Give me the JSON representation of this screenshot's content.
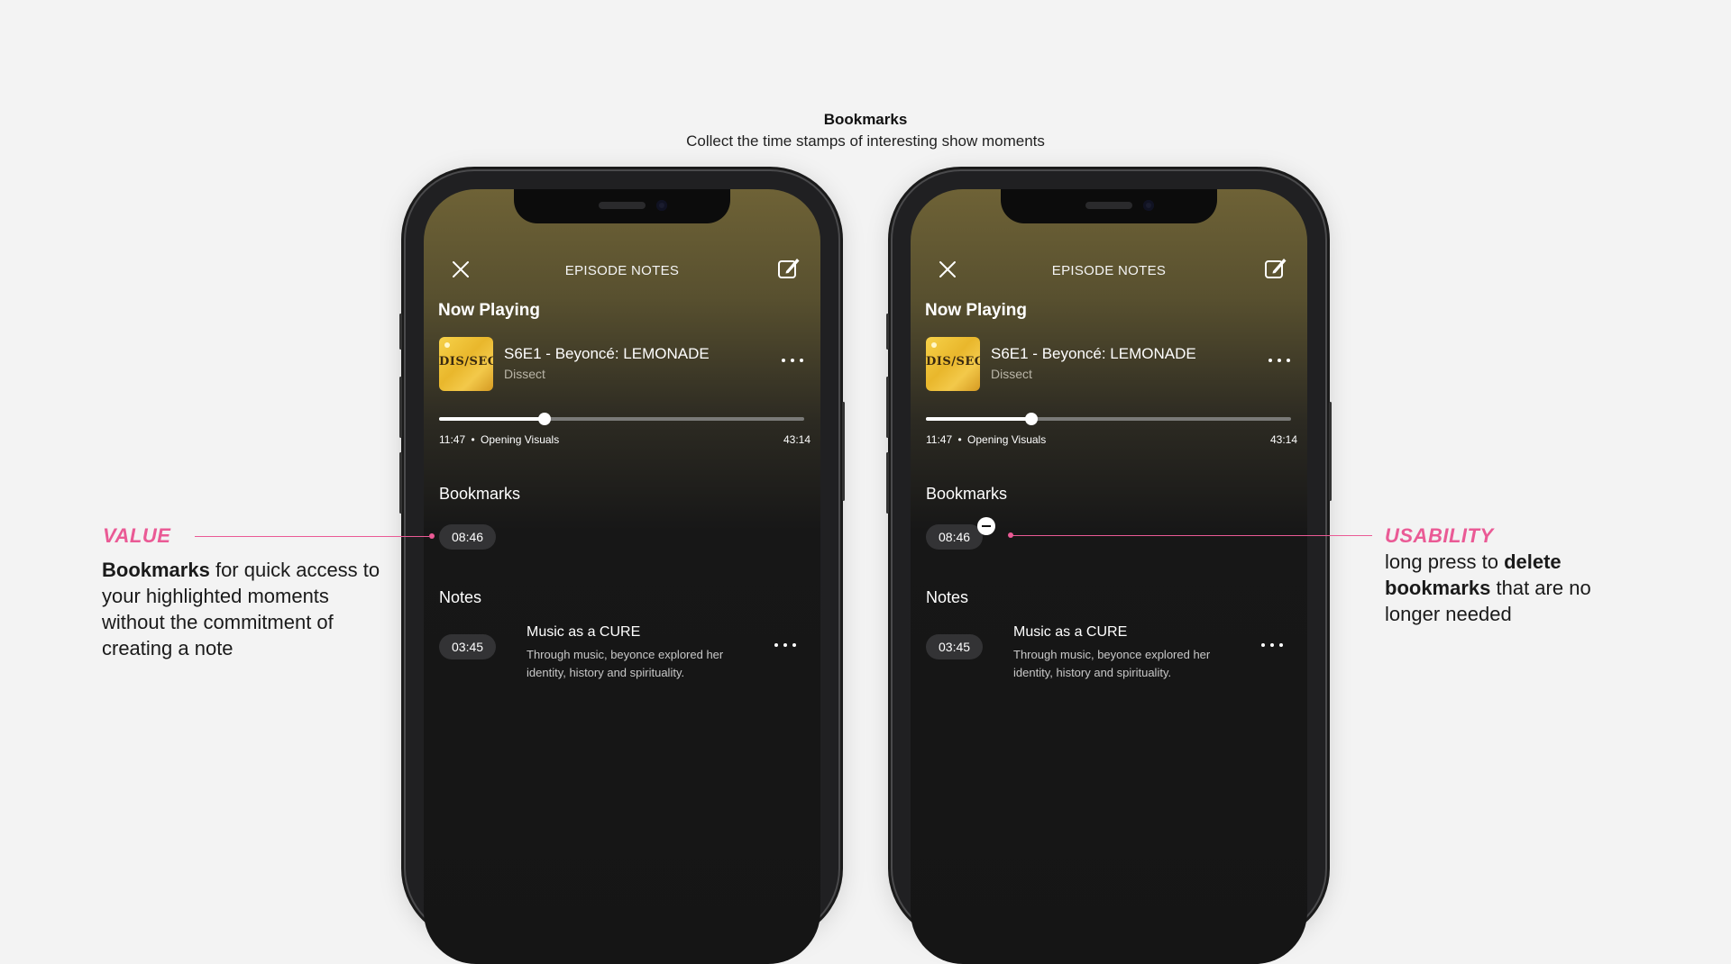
{
  "header": {
    "title": "Bookmarks",
    "subtitle": "Collect the time stamps of interesting show moments"
  },
  "screen": {
    "top_title": "EPISODE NOTES",
    "now_playing_label": "Now Playing",
    "artwork_text": "DIS/SECT",
    "episode_title": "S6E1 - Beyoncé: LEMONADE",
    "show_name": "Dissect",
    "progress_fraction": 0.288,
    "current_time": "11:47",
    "chapter": "Opening Visuals",
    "separator": "•",
    "duration": "43:14",
    "bookmarks_label": "Bookmarks",
    "bookmark_time": "08:46",
    "notes_label": "Notes",
    "note_time": "03:45",
    "note_title": "Music as a CURE",
    "note_body": "Through music, beyonce explored her identity, history and spirituality."
  },
  "annotations": {
    "value": {
      "label": "VALUE",
      "bold": "Bookmarks",
      "rest": " for quick access to your highlighted moments without the commitment of creating a note"
    },
    "usability": {
      "label": "USABILITY",
      "pre": "long press to ",
      "bold": "delete bookmarks",
      "rest": " that are no longer needed"
    }
  },
  "colors": {
    "accent": "#ea5a95",
    "screen_gradient_top": "#6e6236",
    "screen_background": "#151515",
    "pill": "#333335"
  },
  "icons": [
    "close-icon",
    "edit-note-icon",
    "more-dots-icon",
    "remove-icon"
  ]
}
